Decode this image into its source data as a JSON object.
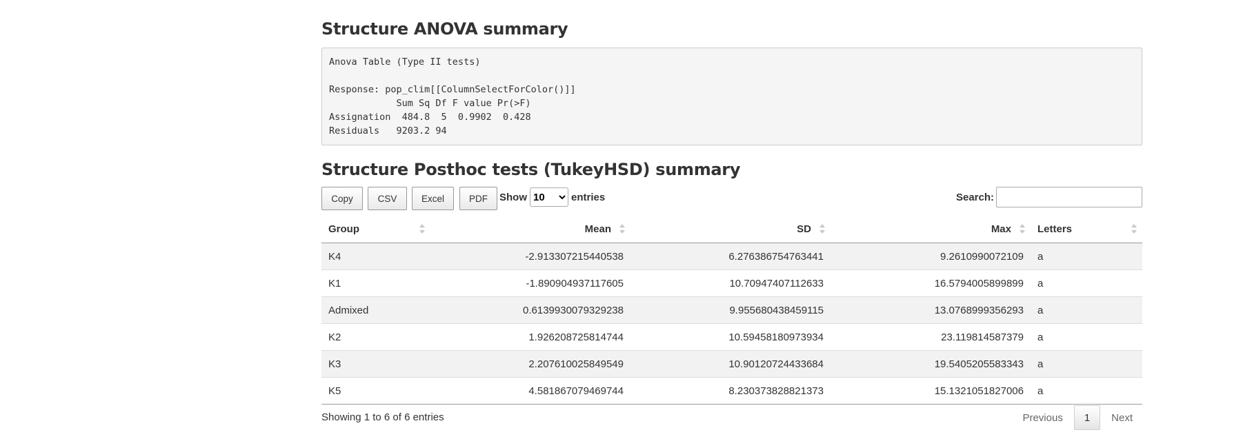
{
  "anova": {
    "title": "Structure ANOVA summary",
    "output": "Anova Table (Type II tests)\n\nResponse: pop_clim[[ColumnSelectForColor()]]\n            Sum Sq Df F value Pr(>F)\nAssignation  484.8  5  0.9902  0.428\nResiduals   9203.2 94"
  },
  "posthoc": {
    "title": "Structure Posthoc tests (TukeyHSD) summary",
    "buttons": {
      "copy": "Copy",
      "csv": "CSV",
      "excel": "Excel",
      "pdf": "PDF"
    },
    "length": {
      "show_label": "Show",
      "selected": "10",
      "entries_label": "entries"
    },
    "search": {
      "label": "Search:",
      "value": ""
    },
    "columns": [
      "Group",
      "Mean",
      "SD",
      "Max",
      "Letters"
    ],
    "rows": [
      {
        "group": "K4",
        "mean": "-2.913307215440538",
        "sd": "6.276386754763441",
        "max": "9.2610990072109",
        "letters": "a"
      },
      {
        "group": "K1",
        "mean": "-1.890904937117605",
        "sd": "10.70947407112633",
        "max": "16.5794005899899",
        "letters": "a"
      },
      {
        "group": "Admixed",
        "mean": "0.6139930079329238",
        "sd": "9.955680438459115",
        "max": "13.0768999356293",
        "letters": "a"
      },
      {
        "group": "K2",
        "mean": "1.926208725814744",
        "sd": "10.59458180973934",
        "max": "23.119814587379",
        "letters": "a"
      },
      {
        "group": "K3",
        "mean": "2.207610025849549",
        "sd": "10.90120724433684",
        "max": "19.5405205583343",
        "letters": "a"
      },
      {
        "group": "K5",
        "mean": "4.581867079469744",
        "sd": "8.230373828821373",
        "max": "15.1321051827006",
        "letters": "a"
      }
    ],
    "info": "Showing 1 to 6 of 6 entries",
    "pagination": {
      "previous": "Previous",
      "current": "1",
      "next": "Next"
    }
  }
}
